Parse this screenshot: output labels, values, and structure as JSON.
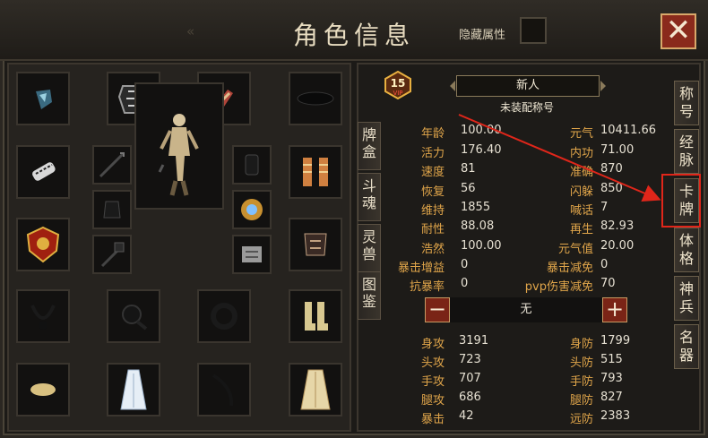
{
  "window": {
    "title": "角色信息",
    "back_arrows": "«",
    "hide_attr_label": "隐藏属性",
    "close_label": "✕"
  },
  "equipment_slots": [
    {
      "name": "gem-icon"
    },
    {
      "name": "armor-vest-icon"
    },
    {
      "name": "bracer-icon"
    },
    {
      "name": "hat-icon"
    },
    {
      "name": "gauntlet-icon"
    },
    {
      "name": "spear-icon"
    },
    {
      "name": "wrist-guard-icon"
    },
    {
      "name": "cloth-icon"
    },
    {
      "name": "boots-pair-icon"
    },
    {
      "name": "emblem-icon"
    },
    {
      "name": "jar-icon"
    },
    {
      "name": "medal-icon"
    },
    {
      "name": "mace-icon"
    },
    {
      "name": "shoulder-armor-icon"
    },
    {
      "name": "belt-armor-icon"
    },
    {
      "name": "necklace-icon"
    },
    {
      "name": "cuff-icon"
    },
    {
      "name": "ring-icon"
    },
    {
      "name": "boots-icon"
    },
    {
      "name": "shoe-icon"
    },
    {
      "name": "robe-icon"
    },
    {
      "name": "blade-icon"
    },
    {
      "name": "cape-icon"
    }
  ],
  "side_tabs_left": [
    {
      "label": "牌盒"
    },
    {
      "label": "斗魂"
    },
    {
      "label": "灵兽"
    },
    {
      "label": "图鉴"
    }
  ],
  "side_tabs_right": [
    {
      "label": "称号"
    },
    {
      "label": "经脉"
    },
    {
      "label": "卡牌"
    },
    {
      "label": "体格"
    },
    {
      "label": "神兵"
    },
    {
      "label": "名器"
    }
  ],
  "vip": {
    "level": "15",
    "badge": "VIP"
  },
  "character": {
    "name": "新人",
    "title_text": "未装配称号"
  },
  "stats_left": [
    {
      "label": "年龄",
      "value": "100.00"
    },
    {
      "label": "活力",
      "value": "176.40"
    },
    {
      "label": "速度",
      "value": "81"
    },
    {
      "label": "恢复",
      "value": "56"
    },
    {
      "label": "维持",
      "value": "1855"
    },
    {
      "label": "耐性",
      "value": "88.08"
    },
    {
      "label": "浩然",
      "value": "100.00"
    },
    {
      "label": "暴击增益",
      "value": "0"
    },
    {
      "label": "抗暴率",
      "value": "0"
    }
  ],
  "stats_right": [
    {
      "label": "元气",
      "value": "10411.66"
    },
    {
      "label": "内功",
      "value": "71.00"
    },
    {
      "label": "准确",
      "value": "870"
    },
    {
      "label": "闪躲",
      "value": "850"
    },
    {
      "label": "喊话",
      "value": "7"
    },
    {
      "label": "再生",
      "value": "82.93"
    },
    {
      "label": "元气值",
      "value": "20.00"
    },
    {
      "label": "暴击减免",
      "value": "0"
    },
    {
      "label": "pvp伤害减免",
      "value": "70"
    }
  ],
  "selector": {
    "minus": "−",
    "value": "无",
    "plus": "+"
  },
  "combat_left": [
    {
      "label": "身攻",
      "value": "3191"
    },
    {
      "label": "头攻",
      "value": "723"
    },
    {
      "label": "手攻",
      "value": "707"
    },
    {
      "label": "腿攻",
      "value": "686"
    },
    {
      "label": "暴击",
      "value": "42"
    }
  ],
  "combat_right": [
    {
      "label": "身防",
      "value": "1799"
    },
    {
      "label": "头防",
      "value": "515"
    },
    {
      "label": "手防",
      "value": "793"
    },
    {
      "label": "腿防",
      "value": "827"
    },
    {
      "label": "远防",
      "value": "2383"
    }
  ],
  "colors": {
    "accent": "#e0a54a",
    "highlight": "#e0261a",
    "close_bg": "#8a2a1c"
  }
}
